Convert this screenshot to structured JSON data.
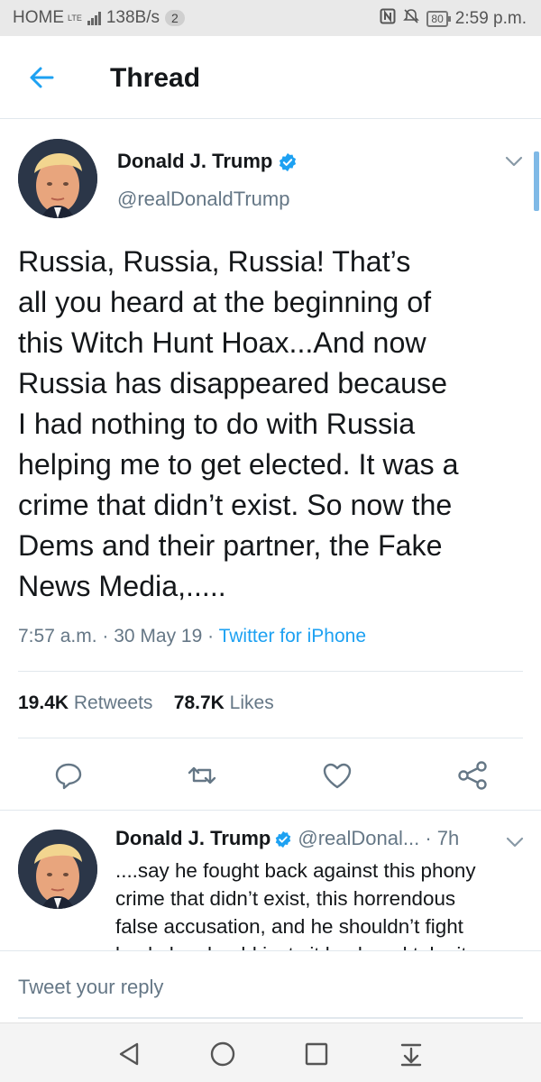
{
  "status_bar": {
    "carrier": "HOME",
    "network_type": "LTE",
    "data_speed": "138B/s",
    "notification_count": "2",
    "battery": "80",
    "time": "2:59 p.m."
  },
  "header": {
    "title": "Thread"
  },
  "main_tweet": {
    "author_name": "Donald J. Trump",
    "author_handle": "@realDonaldTrump",
    "text": "Russia, Russia, Russia! That’s\nall you heard at the beginning of\nthis Witch Hunt Hoax...And now\nRussia has disappeared because\nI had nothing to do with Russia\nhelping me to get elected. It was a\ncrime that didn’t exist. So now the\nDems and their partner, the Fake\nNews Media,.....",
    "time": "7:57 a.m.",
    "date": "30 May 19",
    "client": "Twitter for iPhone",
    "retweets_count": "19.4K",
    "retweets_label": "Retweets",
    "likes_count": "78.7K",
    "likes_label": "Likes"
  },
  "reply_tweet": {
    "author_name": "Donald J. Trump",
    "author_handle": "@realDonal...",
    "age": "7h",
    "text": "....say he fought back against this phony\ncrime that didn’t exist, this horrendous\nfalse accusation, and he shouldn’t fight\nback, he should just sit back and take it."
  },
  "compose": {
    "placeholder": "Tweet your reply"
  },
  "colors": {
    "accent": "#1da1f2",
    "muted": "#657786",
    "text": "#14171a",
    "divider": "#e1e8ed"
  },
  "icons": {
    "back": "arrow-left-icon",
    "verified": "verified-badge-icon",
    "more": "chevron-down-icon",
    "reply": "comment-icon",
    "retweet": "retweet-icon",
    "like": "heart-icon",
    "share": "share-icon",
    "nav_back": "triangle-back-icon",
    "nav_home": "circle-home-icon",
    "nav_recents": "square-recents-icon",
    "nav_notifications": "pull-down-icon"
  }
}
